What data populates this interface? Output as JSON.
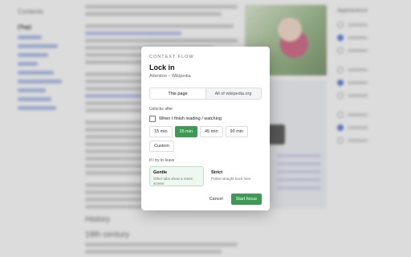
{
  "background": {
    "nav_header": "Contents",
    "nav_top": "(Top)",
    "section_1": "History",
    "section_2": "19th century",
    "right_title": "Appearance"
  },
  "modal": {
    "eyebrow": "CONTEXT FLOW",
    "title": "Lock in",
    "subtitle": "Attention – Wikipedia",
    "scope": {
      "options": [
        "This page",
        "All of wikipedia.org"
      ],
      "selected": "This page"
    },
    "unlock_label": "Unlocks after",
    "checkbox_label": "When I finish reading / watching",
    "checkbox_checked": false,
    "durations": [
      "15 min",
      "25 min",
      "45 min",
      "90 min",
      "Custom"
    ],
    "selected_duration": "25 min",
    "leave_label": "If I try to leave",
    "modes": [
      {
        "title": "Gentle",
        "desc": "Other tabs show a return screen"
      },
      {
        "title": "Strict",
        "desc": "Pulled straight back here"
      }
    ],
    "selected_mode": "Gentle",
    "cancel": "Cancel",
    "start": "Start focus",
    "accent_color": "#3c9a55"
  }
}
